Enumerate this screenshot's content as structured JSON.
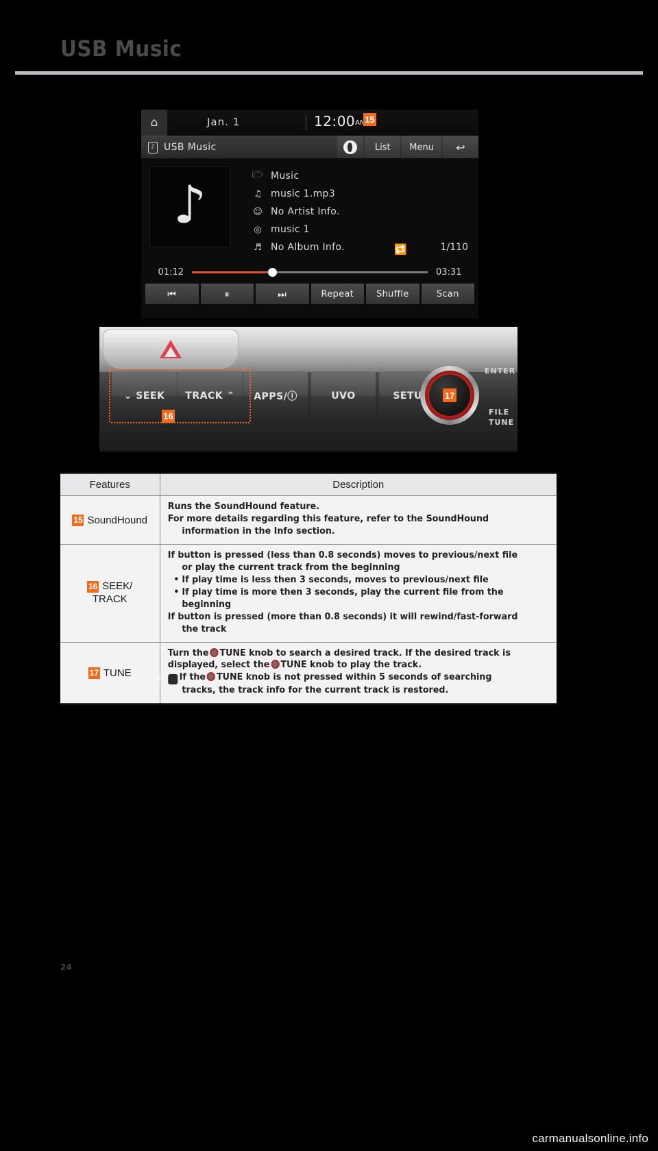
{
  "page": {
    "title": "USB Music",
    "number": "24",
    "watermark": "carmanualsonline.info"
  },
  "screen": {
    "status": {
      "home_icon": "home-icon",
      "date": "Jan.  1",
      "time": "12:00",
      "ampm": "AM",
      "badge": "15"
    },
    "titlebar": {
      "source_icon": "usb-music-icon",
      "source_label": "USB Music",
      "soundhound_icon": "soundhound-icon",
      "list_label": "List",
      "menu_label": "Menu",
      "back_icon": "back-arrow-icon"
    },
    "nowplaying": {
      "album_art_icon": "music-note-icon",
      "rows": [
        {
          "icon": "folder-icon",
          "glyph": "🗀",
          "text": "Music"
        },
        {
          "icon": "note-icon",
          "glyph": "♫",
          "text": "music 1.mp3"
        },
        {
          "icon": "artist-icon",
          "glyph": "Ȧ",
          "text": "No Artist Info."
        },
        {
          "icon": "disc-icon",
          "glyph": "◎",
          "text": "music 1"
        },
        {
          "icon": "album-icon",
          "glyph": "♪",
          "text": "No Album Info."
        }
      ],
      "repeat_icon": "repeat-icon",
      "track_count": "1/110",
      "elapsed": "01:12",
      "total": "03:31",
      "progress_percent": 34
    },
    "transport": [
      {
        "name": "previous-track-button",
        "label": "⏮"
      },
      {
        "name": "pause-button",
        "label": "⏸"
      },
      {
        "name": "next-track-button",
        "label": "⏭"
      },
      {
        "name": "repeat-button",
        "label": "Repeat"
      },
      {
        "name": "shuffle-button",
        "label": "Shuffle"
      },
      {
        "name": "scan-button",
        "label": "Scan"
      }
    ]
  },
  "panel": {
    "hazard_icon": "hazard-warning-icon",
    "buttons": [
      {
        "name": "seek-button",
        "label": "⌄ SEEK"
      },
      {
        "name": "track-button",
        "label": "TRACK ⌃"
      },
      {
        "name": "apps-info-button",
        "label": "APPS/ⓘ"
      },
      {
        "name": "uvo-button",
        "label": "UVO"
      },
      {
        "name": "setup-button",
        "label": "SETUP"
      }
    ],
    "badge_seek_track": "16",
    "badge_tune": "17",
    "knob_labels": {
      "enter": "ENTER",
      "file": "FILE",
      "tune": "TUNE"
    }
  },
  "table": {
    "headers": {
      "features": "Features",
      "description": "Description"
    },
    "rows": [
      {
        "badge": "15",
        "feature": "SoundHound",
        "feature_second": "",
        "desc_lines": [
          "Runs the SoundHound feature.",
          "For more details regarding this feature, refer to the SoundHound information in the Info section."
        ]
      },
      {
        "badge": "16",
        "feature": "SEEK/",
        "feature_second": "TRACK",
        "desc_intro": "If button is pressed (less than 0.8 seconds) moves to previous/next file or play the current track from the beginning",
        "bullets": [
          "If play time is less then 3 seconds, moves to previous/next file",
          "If play time is more then 3 seconds, play the current file from the beginning"
        ],
        "desc_outro": "If button is pressed (more than 0.8 seconds) it will rewind/fast-forward the track"
      },
      {
        "badge": "17",
        "feature": "TUNE",
        "feature_second": "",
        "tune_line_a1": "Turn the",
        "tune_line_a2": "TUNE knob to search a desired track. If the desired track is displayed, select the",
        "tune_line_a3": "TUNE knob to play the track.",
        "note_icon": "info-icon",
        "note_a1": "If the",
        "note_a2": "TUNE knob is not pressed within 5 seconds of searching tracks, the track info for the current track is restored."
      }
    ]
  },
  "colors": {
    "accent_orange": "#ee6b1f",
    "progress_orange": "#e1502a",
    "knob_red": "#b8201d"
  }
}
